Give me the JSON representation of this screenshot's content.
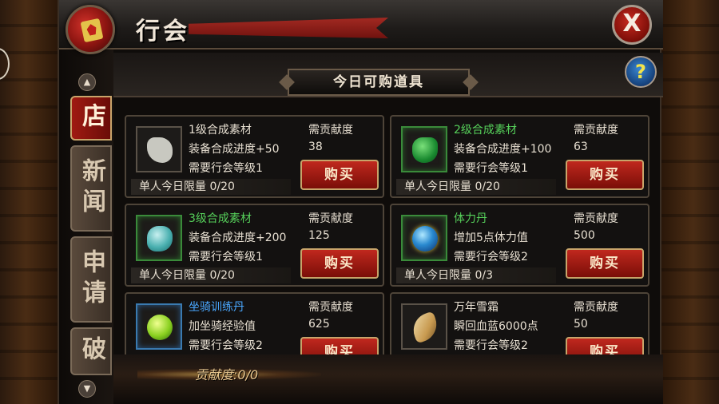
{
  "window": {
    "title": "行会",
    "close_label": "X",
    "help_label": "?"
  },
  "section": {
    "title": "今日可购道具"
  },
  "side_tabs": [
    {
      "label": "店",
      "active": true
    },
    {
      "label": "新闻",
      "active": false
    },
    {
      "label": "申请",
      "active": false
    },
    {
      "label": "破",
      "active": false
    }
  ],
  "nav_arrows": {
    "up": "▲",
    "down": "▼"
  },
  "items": [
    {
      "name": "1级合成素材",
      "name_color": "#e8e0d2",
      "icon": "gray-stone-icon",
      "desc": "装备合成进度+50",
      "req": "需要行会等级1",
      "cost_label": "需贡献度",
      "cost": "38",
      "buy_label": "购买",
      "limit": "单人今日限量 0/20"
    },
    {
      "name": "2级合成素材",
      "name_color": "#56d05a",
      "icon": "green-gem-icon",
      "desc": "装备合成进度+100",
      "req": "需要行会等级1",
      "cost_label": "需贡献度",
      "cost": "63",
      "buy_label": "购买",
      "limit": "单人今日限量 0/20"
    },
    {
      "name": "3级合成素材",
      "name_color": "#56d05a",
      "icon": "teal-gem-icon",
      "desc": "装备合成进度+200",
      "req": "需要行会等级1",
      "cost_label": "需贡献度",
      "cost": "125",
      "buy_label": "购买",
      "limit": "单人今日限量 0/20"
    },
    {
      "name": "体力丹",
      "name_color": "#56d05a",
      "icon": "stamina-orb-icon",
      "desc": "增加5点体力值",
      "req": "需要行会等级2",
      "cost_label": "需贡献度",
      "cost": "500",
      "buy_label": "购买",
      "limit": "单人今日限量 0/3"
    },
    {
      "name": "坐骑训练丹",
      "name_color": "#4aa8ff",
      "icon": "mount-pill-icon",
      "desc": "加坐骑经验值",
      "req": "需要行会等级2",
      "cost_label": "需贡献度",
      "cost": "625",
      "buy_label": "购买",
      "limit": ""
    },
    {
      "name": "万年雪霜",
      "name_color": "#e8e0d2",
      "icon": "ginseng-root-icon",
      "desc": "瞬回血蓝6000点",
      "req": "需要行会等级2",
      "cost_label": "需贡献度",
      "cost": "50",
      "buy_label": "购买",
      "limit": ""
    }
  ],
  "footer": {
    "contribution": "贡献度:0/0"
  }
}
